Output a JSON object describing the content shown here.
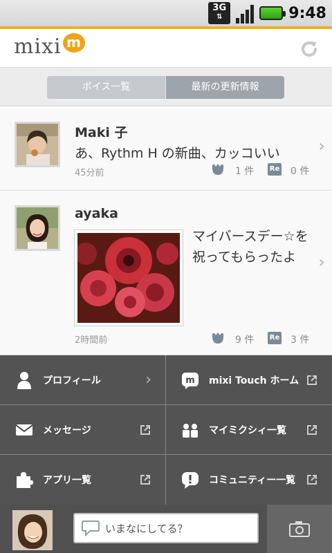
{
  "status_bar": {
    "network": "3G",
    "time": "9:48"
  },
  "header": {
    "logo_text": "mixi",
    "logo_mark": "m"
  },
  "tabs": [
    {
      "label": "ボイス一覧"
    },
    {
      "label": "最新の更新情報"
    }
  ],
  "feed": [
    {
      "author": "Maki 子",
      "text": "あ、Rythm H の新曲、カッコいい",
      "time": "45分前",
      "likes": "1 件",
      "comments": "0 件"
    },
    {
      "author": "ayaka",
      "text_line1": "マイバースデー☆を",
      "text_line2": "祝ってもらったよ",
      "time": "2時間前",
      "likes": "9 件",
      "comments": "3 件"
    }
  ],
  "menu": [
    {
      "label": "プロフィール",
      "icon": "person-icon"
    },
    {
      "label": "mixi Touch ホーム",
      "icon": "mixi-home-icon"
    },
    {
      "label": "メッセージ",
      "icon": "mail-icon"
    },
    {
      "label": "マイミクシィ一覧",
      "icon": "friends-icon"
    },
    {
      "label": "アプリ一覧",
      "icon": "puzzle-icon"
    },
    {
      "label": "コミュニティー一覧",
      "icon": "community-icon"
    }
  ],
  "compose": {
    "placeholder": "いまなにしてる？"
  },
  "colors": {
    "accent": "#f0b21a",
    "menu_bg": "#464646"
  }
}
